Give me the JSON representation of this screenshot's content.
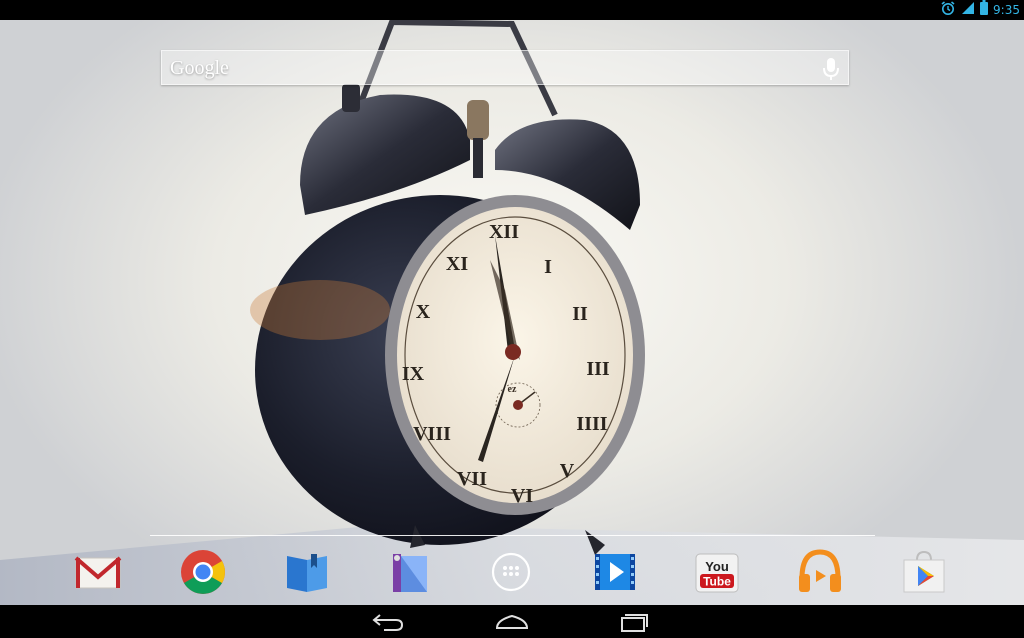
{
  "status_bar": {
    "time": "9:35",
    "icons": [
      "alarm-icon",
      "signal-icon",
      "battery-icon"
    ]
  },
  "search": {
    "logo": "Google"
  },
  "clock_face": {
    "numerals": [
      "XII",
      "I",
      "II",
      "III",
      "IIII",
      "V",
      "VI",
      "VII",
      "VIII",
      "IX",
      "X",
      "XI"
    ],
    "brand": "ez"
  },
  "dock": [
    {
      "name": "gmail-icon",
      "label": "Gmail"
    },
    {
      "name": "chrome-icon",
      "label": "Chrome"
    },
    {
      "name": "play-books-icon",
      "label": "Play Books"
    },
    {
      "name": "play-magazines-icon",
      "label": "Play Magazines"
    },
    {
      "name": "app-drawer-icon",
      "label": "Apps"
    },
    {
      "name": "play-movies-icon",
      "label": "Play Movies"
    },
    {
      "name": "youtube-icon",
      "label": "YouTube"
    },
    {
      "name": "play-music-icon",
      "label": "Play Music"
    },
    {
      "name": "play-store-icon",
      "label": "Play Store"
    }
  ],
  "youtube_logo": {
    "top": "You",
    "bottom": "Tube"
  },
  "nav": [
    "back-icon",
    "home-icon",
    "recent-apps-icon"
  ],
  "colors": {
    "status_accent": "#33b5e5",
    "gmail_red": "#c1272d",
    "youtube_red": "#cc181e",
    "music_orange": "#f38e1d"
  }
}
